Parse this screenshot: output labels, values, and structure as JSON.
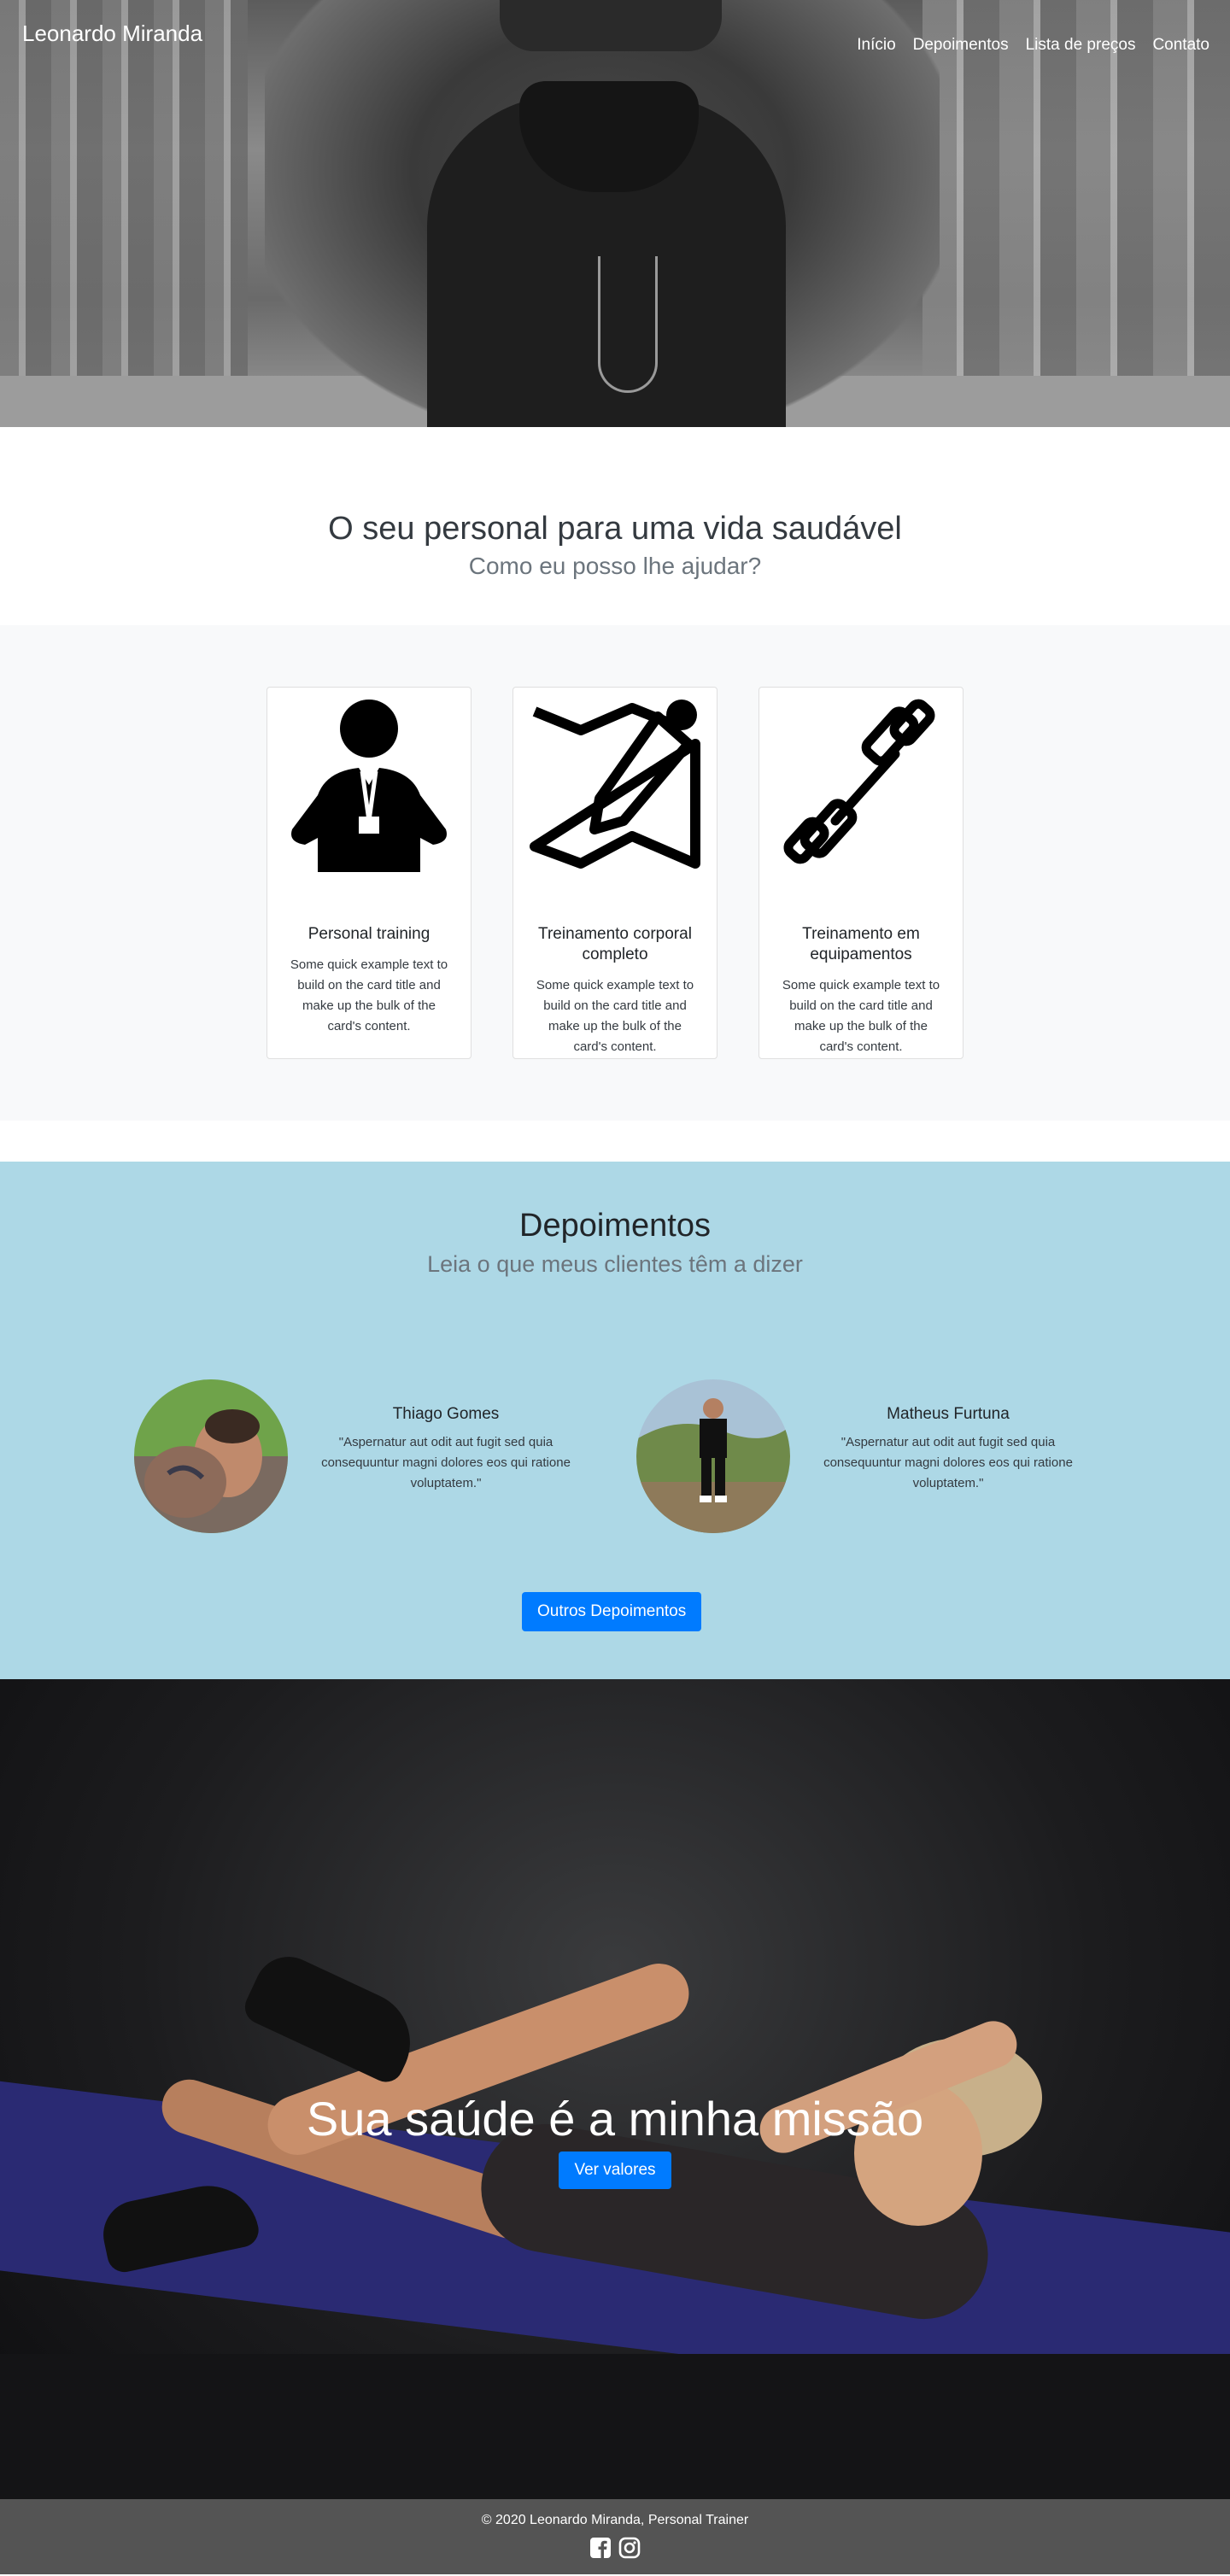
{
  "brand": "Leonardo Miranda",
  "nav": [
    "Início",
    "Depoimentos",
    "Lista de preços",
    "Contato"
  ],
  "intro": {
    "title": "O seu personal para uma vida saudável",
    "subtitle": "Como eu posso lhe ajudar?"
  },
  "services": [
    {
      "title": "Personal training",
      "text": "Some quick example text to build on the card title and make up the bulk of the card's content.",
      "icon": "personal-trainer-icon"
    },
    {
      "title": "Treinamento corporal completo",
      "text": "Some quick example text to build on the card title and make up the bulk of the card's content.",
      "icon": "map-pencil-icon"
    },
    {
      "title": "Treinamento em equipamentos",
      "text": "Some quick example text to build on the card title and make up the bulk of the card's content.",
      "icon": "dumbbell-icon"
    }
  ],
  "testimonials": {
    "title": "Depoimentos",
    "subtitle": "Leia o que meus clientes têm a dizer",
    "items": [
      {
        "name": "Thiago Gomes",
        "quote": "\"Aspernatur aut odit aut fugit sed quia consequuntur magni dolores eos qui ratione voluptatem.\""
      },
      {
        "name": "Matheus Furtuna",
        "quote": "\"Aspernatur aut odit aut fugit sed quia consequuntur magni dolores eos qui ratione voluptatem.\""
      }
    ],
    "button": "Outros Depoimentos"
  },
  "mission": {
    "title": "Sua saúde é a minha missão",
    "button": "Ver valores"
  },
  "footer": {
    "copyright": "© 2020 Leonardo Miranda, Personal Trainer",
    "social": [
      "facebook-icon",
      "instagram-icon"
    ]
  },
  "colors": {
    "primary": "#007bff",
    "testimonials_bg": "#add8e6",
    "services_bg": "#f8f9fa",
    "footer_bg": "#545454"
  }
}
